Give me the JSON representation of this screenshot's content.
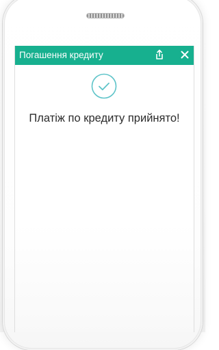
{
  "app_bar": {
    "title": "Погашення кредиту",
    "background_color": "#17b08f",
    "share_icon": "share-icon",
    "close_icon": "close-icon"
  },
  "content": {
    "status_icon": "checkmark-circle-icon",
    "status_icon_color": "#5fc4c9",
    "message": "Платіж по кредиту прийнято!"
  }
}
